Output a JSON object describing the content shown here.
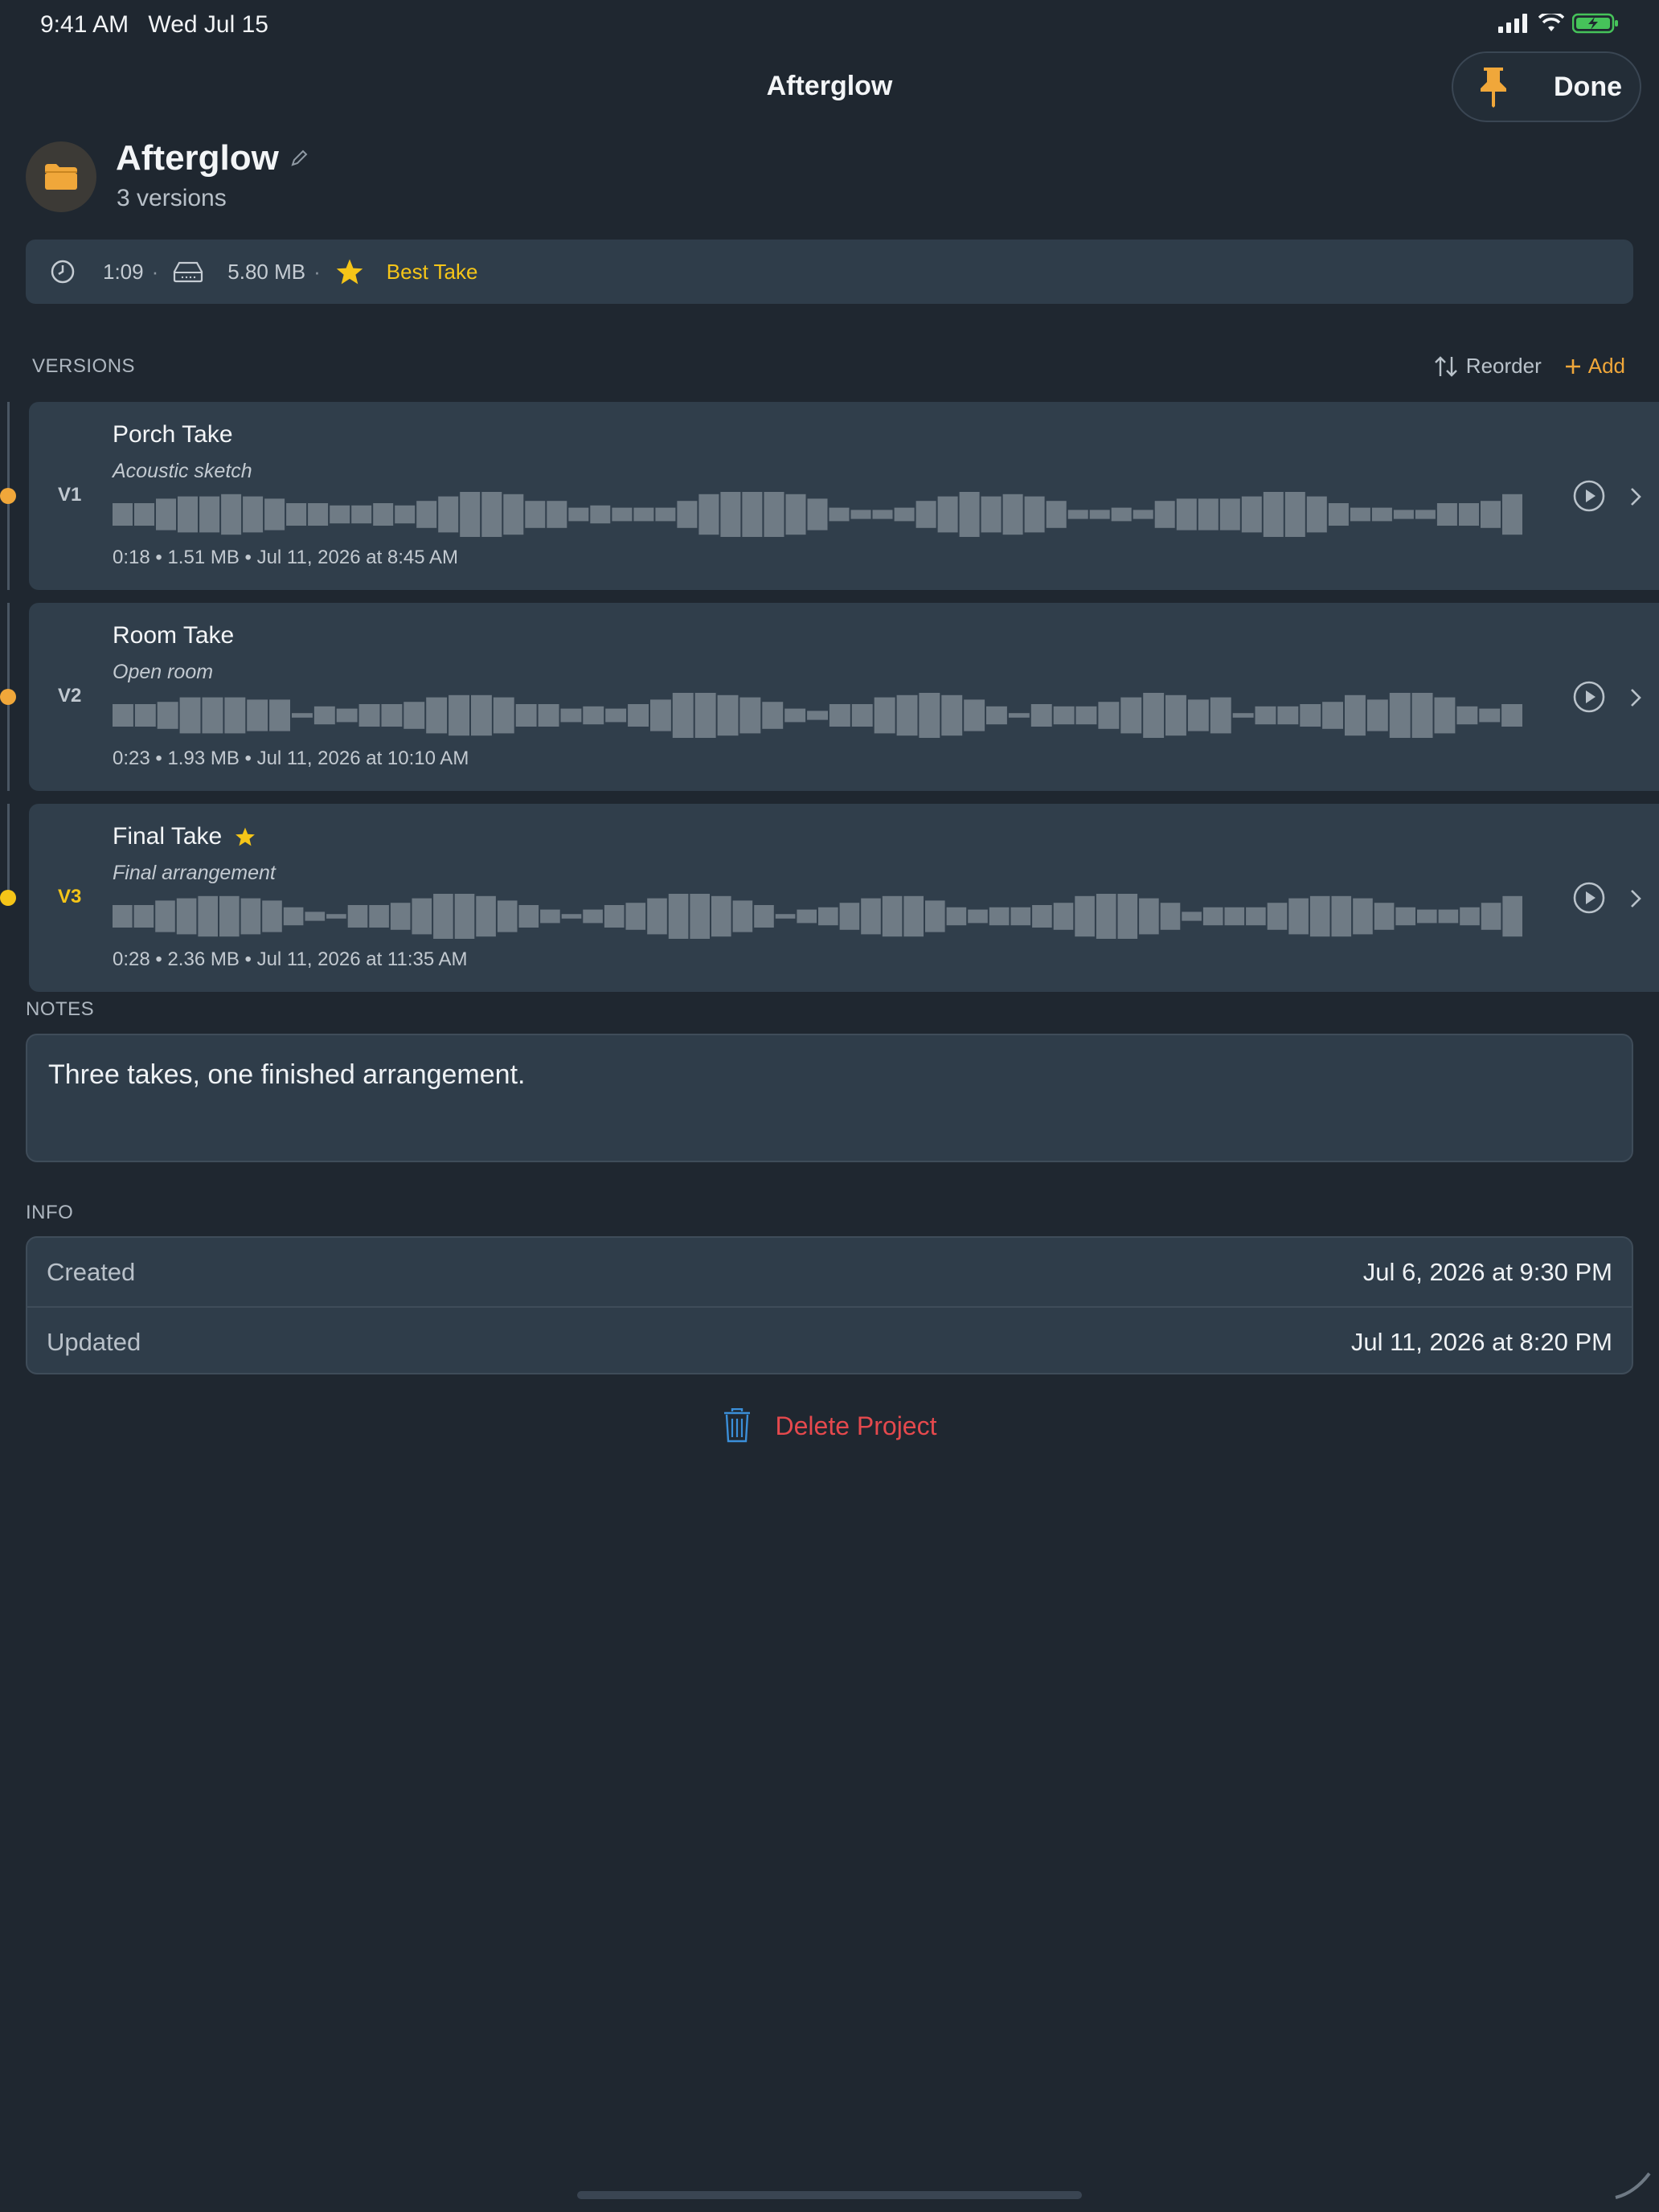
{
  "status_bar": {
    "time": "9:41 AM",
    "date": "Wed Jul 15"
  },
  "nav": {
    "title": "Afterglow",
    "done_label": "Done",
    "pin_icon": "pin-icon"
  },
  "project": {
    "title": "Afterglow",
    "subtitle": "3 versions",
    "folder_color": "#f0a73a"
  },
  "summary": {
    "duration": "1:09",
    "size": "5.80 MB",
    "best_take_label": "Best Take"
  },
  "versions_section": {
    "label": "VERSIONS",
    "reorder_label": "Reorder",
    "add_label": "Add"
  },
  "versions": [
    {
      "tag": "V1",
      "title": "Porch Take",
      "subtitle": "Acoustic sketch",
      "meta": "0:18 • 1.51 MB • Jul 11, 2026 at 8:45 AM",
      "best": false,
      "tag_color": "#c0c8d0",
      "dot_color": "#f0a73a",
      "wave": [
        0.5,
        0.5,
        0.7,
        0.8,
        0.8,
        0.9,
        0.8,
        0.7,
        0.5,
        0.5,
        0.4,
        0.4,
        0.5,
        0.4,
        0.6,
        0.8,
        1.0,
        1.0,
        0.9,
        0.6,
        0.6,
        0.3,
        0.4,
        0.3,
        0.3,
        0.3,
        0.6,
        0.9,
        1.0,
        1.0,
        1.0,
        0.9,
        0.7,
        0.3,
        0.2,
        0.2,
        0.3,
        0.6,
        0.8,
        1.0,
        0.8,
        0.9,
        0.8,
        0.6,
        0.2,
        0.2,
        0.3,
        0.2,
        0.6,
        0.7,
        0.7,
        0.7,
        0.8,
        1.0,
        1.0,
        0.8,
        0.5,
        0.3,
        0.3,
        0.2,
        0.2,
        0.5,
        0.5,
        0.6,
        0.9
      ]
    },
    {
      "tag": "V2",
      "title": "Room Take",
      "subtitle": "Open room",
      "meta": "0:23 • 1.93 MB • Jul 11, 2026 at 10:10 AM",
      "best": false,
      "tag_color": "#c0c8d0",
      "dot_color": "#f0a73a",
      "wave": [
        0.5,
        0.5,
        0.6,
        0.8,
        0.8,
        0.8,
        0.7,
        0.7,
        0.1,
        0.4,
        0.3,
        0.5,
        0.5,
        0.6,
        0.8,
        0.9,
        0.9,
        0.8,
        0.5,
        0.5,
        0.3,
        0.4,
        0.3,
        0.5,
        0.7,
        1.0,
        1.0,
        0.9,
        0.8,
        0.6,
        0.3,
        0.2,
        0.5,
        0.5,
        0.8,
        0.9,
        1.0,
        0.9,
        0.7,
        0.4,
        0.1,
        0.5,
        0.4,
        0.4,
        0.6,
        0.8,
        1.0,
        0.9,
        0.7,
        0.8,
        0.1,
        0.4,
        0.4,
        0.5,
        0.6,
        0.9,
        0.7,
        1.0,
        1.0,
        0.8,
        0.4,
        0.3,
        0.5
      ]
    },
    {
      "tag": "V3",
      "title": "Final Take",
      "subtitle": "Final arrangement",
      "meta": "0:28 • 2.36 MB • Jul 11, 2026 at 11:35 AM",
      "best": true,
      "tag_color": "#f5c518",
      "dot_color": "#f5c518",
      "wave": [
        0.5,
        0.5,
        0.7,
        0.8,
        0.9,
        0.9,
        0.8,
        0.7,
        0.4,
        0.2,
        0.1,
        0.5,
        0.5,
        0.6,
        0.8,
        1.0,
        1.0,
        0.9,
        0.7,
        0.5,
        0.3,
        0.1,
        0.3,
        0.5,
        0.6,
        0.8,
        1.0,
        1.0,
        0.9,
        0.7,
        0.5,
        0.1,
        0.3,
        0.4,
        0.6,
        0.8,
        0.9,
        0.9,
        0.7,
        0.4,
        0.3,
        0.4,
        0.4,
        0.5,
        0.6,
        0.9,
        1.0,
        1.0,
        0.8,
        0.6,
        0.2,
        0.4,
        0.4,
        0.4,
        0.6,
        0.8,
        0.9,
        0.9,
        0.8,
        0.6,
        0.4,
        0.3,
        0.3,
        0.4,
        0.6,
        0.9
      ]
    }
  ],
  "notes": {
    "label": "NOTES",
    "text": "Three takes, one finished arrangement."
  },
  "info": {
    "label": "INFO",
    "rows": [
      {
        "key": "Created",
        "value": "Jul 6, 2026 at 9:30 PM"
      },
      {
        "key": "Updated",
        "value": "Jul 11, 2026 at 8:20 PM"
      }
    ]
  },
  "delete": {
    "label": "Delete Project"
  },
  "colors": {
    "accent": "#f0a73a",
    "best": "#f5c518",
    "danger": "#e5494d",
    "link": "#3b8fd9"
  }
}
